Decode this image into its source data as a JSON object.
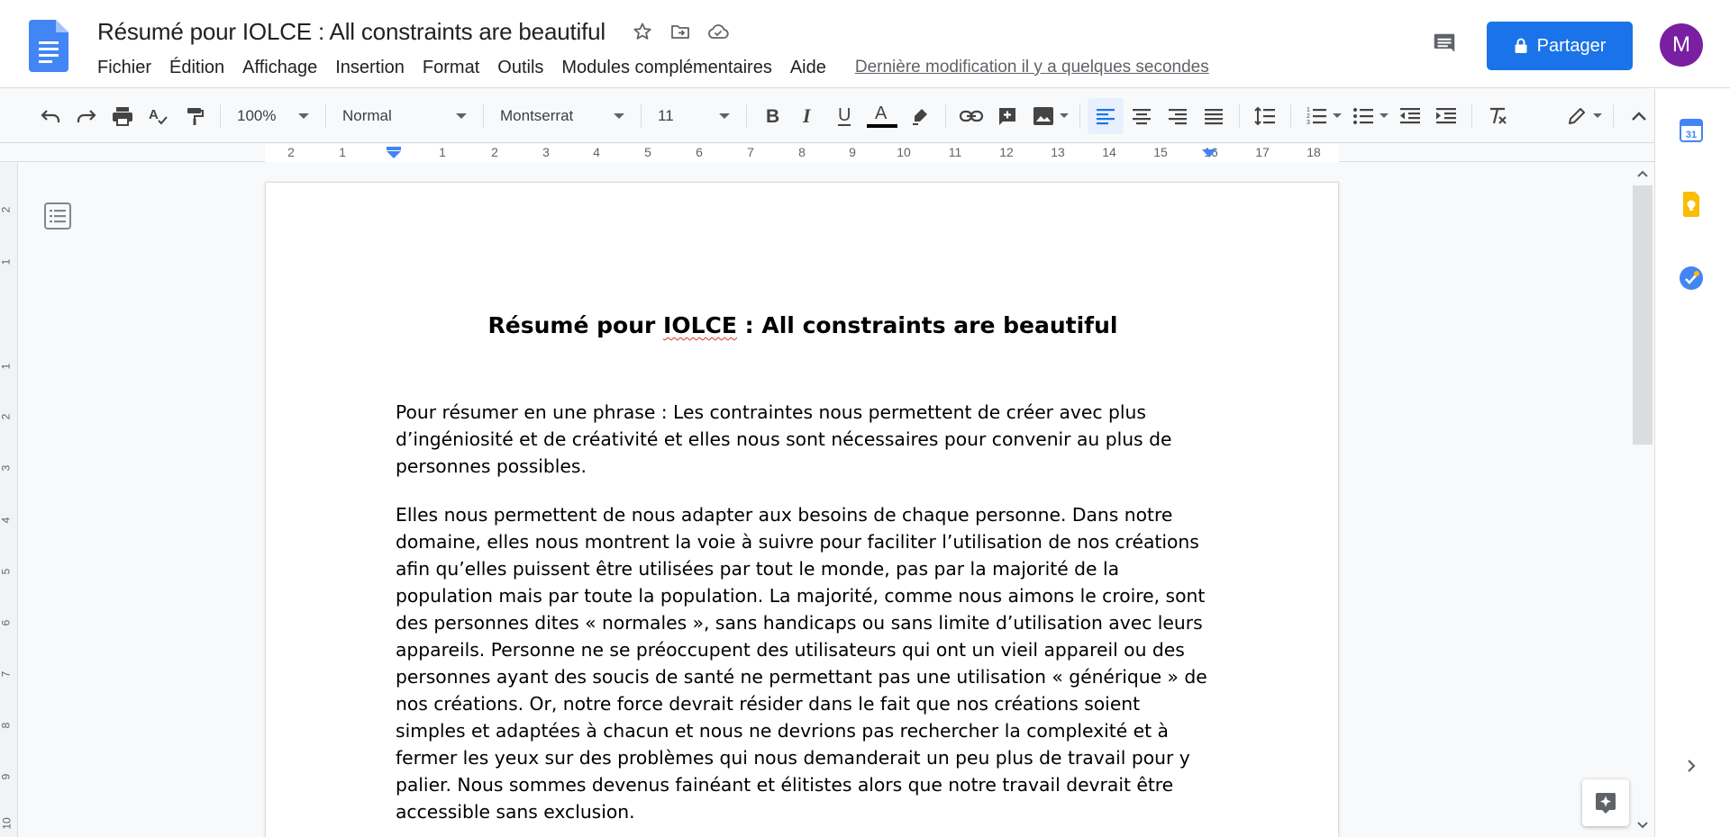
{
  "header": {
    "doc_title": "Résumé pour IOLCE : All constraints are beautiful",
    "menu": [
      "Fichier",
      "Édition",
      "Affichage",
      "Insertion",
      "Format",
      "Outils",
      "Modules complémentaires",
      "Aide"
    ],
    "last_edit": "Dernière modification il y a quelques secondes",
    "share_label": "Partager",
    "avatar_letter": "M",
    "avatar_color": "#7b1fa2",
    "accent_color": "#1a73e8"
  },
  "toolbar": {
    "zoom": "100%",
    "style": "Normal",
    "font": "Montserrat",
    "font_size": "11"
  },
  "ruler": {
    "numbers": [
      "2",
      "1",
      "1",
      "2",
      "3",
      "4",
      "5",
      "6",
      "7",
      "8",
      "9",
      "10",
      "11",
      "12",
      "13",
      "14",
      "15",
      "16",
      "17",
      "18"
    ]
  },
  "vertical_ruler": {
    "numbers": [
      "2",
      "1",
      "1",
      "2",
      "3",
      "4",
      "5",
      "6",
      "7",
      "8",
      "9",
      "10"
    ]
  },
  "document": {
    "heading_before": "Résumé pour ",
    "heading_misspelled": "IOLCE",
    "heading_after": " : All constraints are beautiful",
    "paragraphs": [
      "Pour résumer en une phrase : Les contraintes nous permettent de créer avec plus d’ingéniosité et de créativité et elles nous sont nécessaires pour convenir au plus de personnes possibles.",
      "Elles nous permettent de nous adapter aux besoins de chaque personne. Dans notre domaine, elles nous montrent la voie à suivre pour faciliter l’utilisation de nos créations afin qu’elles puissent être utilisées par tout le monde, pas par la majorité de la population mais par toute la population. La majorité, comme nous aimons le croire, sont des personnes dites « normales », sans handicaps ou sans limite d’utilisation avec leurs appareils. Personne ne se préoccupent des utilisateurs qui ont un vieil appareil ou des personnes ayant des soucis de santé ne permettant pas une utilisation « générique » de nos créations. Or, notre force devrait résider dans le fait que nos créations soient simples et adaptées à chacun et nous ne devrions pas rechercher la complexité et à fermer les yeux sur des problèmes qui nous demanderait un peu plus de travail pour y palier. Nous sommes devenus fainéant et élitistes alors que notre travail devrait être accessible sans exclusion."
    ]
  },
  "side_panel": {
    "apps": [
      "calendar-icon",
      "keep-icon",
      "tasks-icon"
    ],
    "calendar_day": "31"
  }
}
